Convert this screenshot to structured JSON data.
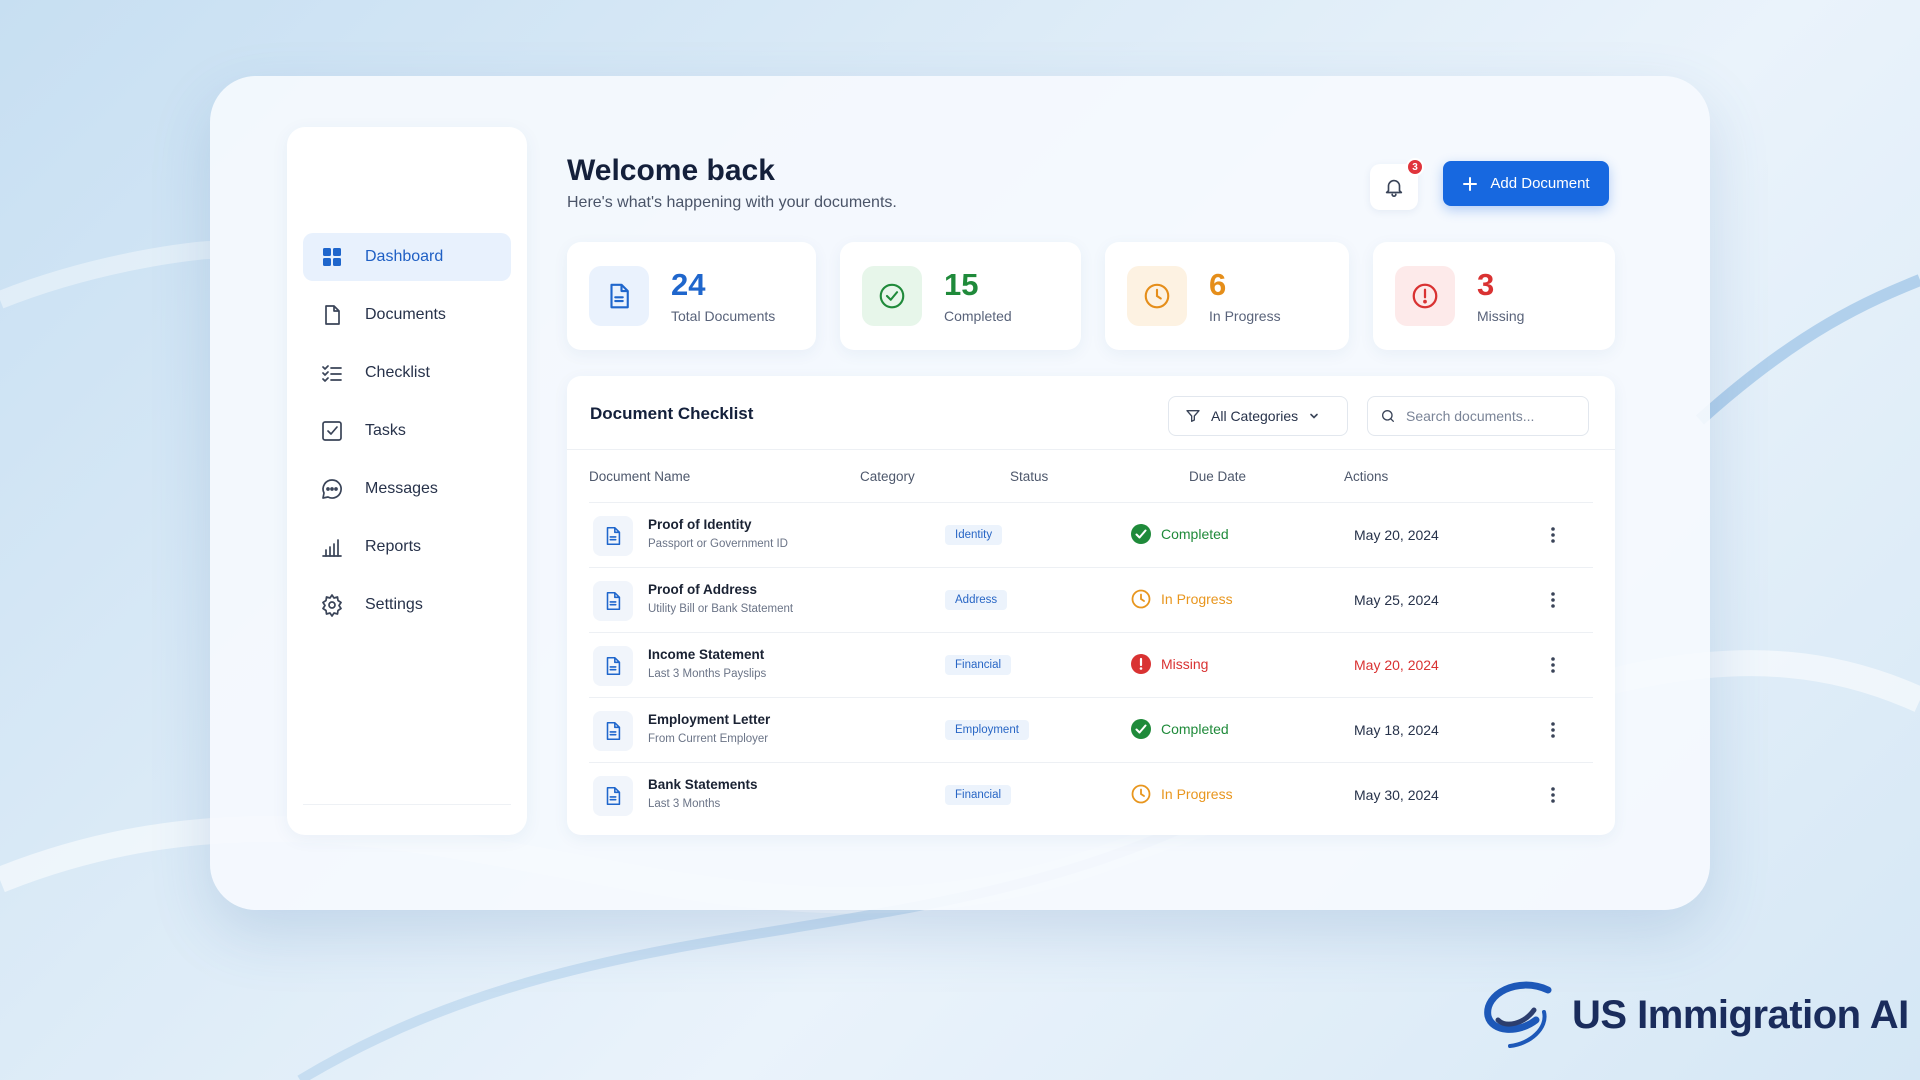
{
  "header": {
    "title": "Welcome back",
    "subtitle": "Here's what's happening with your documents.",
    "notification_count": "3",
    "add_button_label": "Add Document"
  },
  "sidebar": {
    "items": [
      {
        "label": "Dashboard",
        "icon": "grid-icon",
        "active": true
      },
      {
        "label": "Documents",
        "icon": "file-icon",
        "active": false
      },
      {
        "label": "Checklist",
        "icon": "checklist-icon",
        "active": false
      },
      {
        "label": "Tasks",
        "icon": "checkbox-icon",
        "active": false
      },
      {
        "label": "Messages",
        "icon": "chat-icon",
        "active": false
      },
      {
        "label": "Reports",
        "icon": "bar-chart-icon",
        "active": false
      },
      {
        "label": "Settings",
        "icon": "gear-icon",
        "active": false
      }
    ]
  },
  "stats": [
    {
      "value": "24",
      "label": "Total Documents",
      "color": "#1f66cc",
      "bg": "#eaf2fd",
      "icon": "document-icon"
    },
    {
      "value": "15",
      "label": "Completed",
      "color": "#1f8a3a",
      "bg": "#e7f6ea",
      "icon": "check-circle-icon"
    },
    {
      "value": "6",
      "label": "In Progress",
      "color": "#e58e1a",
      "bg": "#fdf2e2",
      "icon": "clock-icon"
    },
    {
      "value": "3",
      "label": "Missing",
      "color": "#d93232",
      "bg": "#fdeaea",
      "icon": "alert-icon"
    }
  ],
  "checklist": {
    "title": "Document Checklist",
    "filter_label": "All Categories",
    "search_placeholder": "Search documents...",
    "columns": [
      "Document Name",
      "Category",
      "Status",
      "Due Date",
      "Actions"
    ],
    "rows": [
      {
        "name": "Proof of Identity",
        "desc": "Passport or Government ID",
        "category": "Identity",
        "status": "Completed",
        "due": "May 20, 2024"
      },
      {
        "name": "Proof of Address",
        "desc": "Utility Bill or Bank Statement",
        "category": "Address",
        "status": "In Progress",
        "due": "May 25, 2024"
      },
      {
        "name": "Income Statement",
        "desc": "Last 3 Months Payslips",
        "category": "Financial",
        "status": "Missing",
        "due": "May 20, 2024"
      },
      {
        "name": "Employment Letter",
        "desc": "From Current Employer",
        "category": "Employment",
        "status": "Completed",
        "due": "May 18, 2024"
      },
      {
        "name": "Bank Statements",
        "desc": "Last 3 Months",
        "category": "Financial",
        "status": "In Progress",
        "due": "May 30, 2024"
      }
    ]
  },
  "status_colors": {
    "Completed": "#1f8a3a",
    "In Progress": "#e8961e",
    "Missing": "#d93232"
  },
  "brand": {
    "name": "US Immigration AI"
  }
}
